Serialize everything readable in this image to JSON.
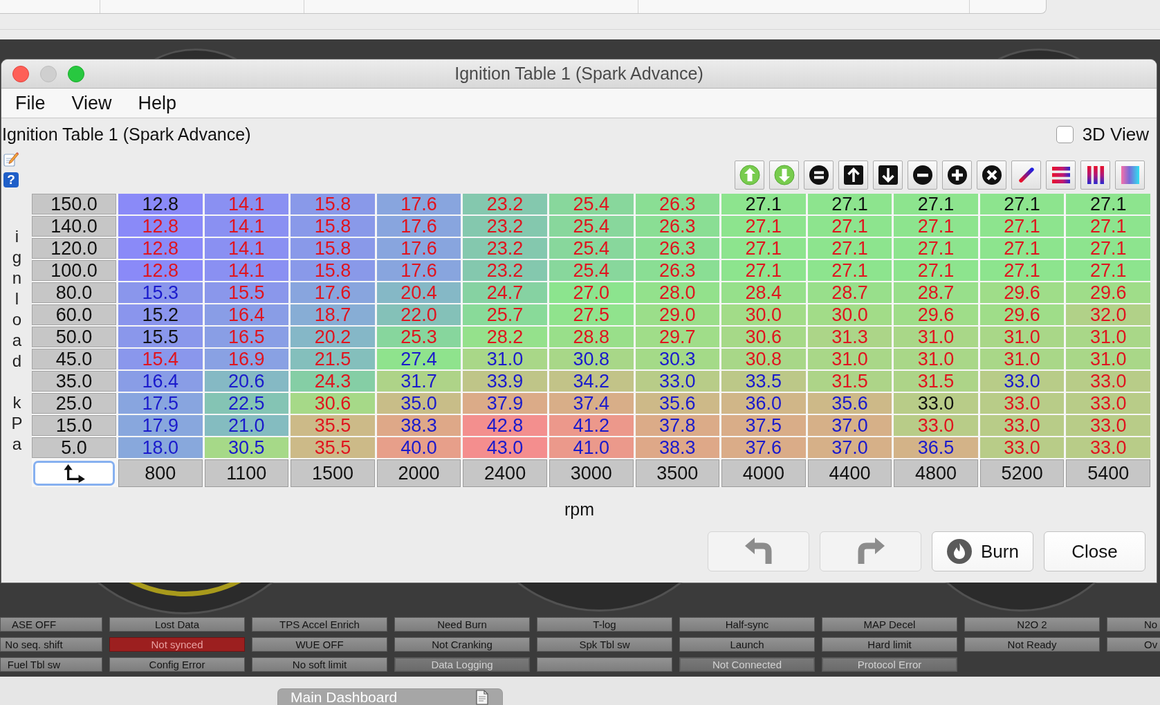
{
  "window": {
    "title": "Ignition Table 1 (Spark Advance)",
    "controls": [
      {
        "kind": "close",
        "disabled": false
      },
      {
        "kind": "minimize",
        "disabled": true
      },
      {
        "kind": "zoom",
        "disabled": false
      }
    ]
  },
  "menu": [
    "File",
    "View",
    "Help"
  ],
  "table_panel": {
    "title": "Ignition Table 1 (Spark Advance)",
    "view_3d": {
      "label": "3D View",
      "checked": false
    },
    "help_glyph": "?",
    "y_axis": {
      "label": "ignload kPa"
    },
    "rows": [
      {
        "load": "150.0",
        "cells": [
          {
            "value": "12.8",
            "color": "#8a8af8",
            "ink": {
              "color": "#111111"
            }
          },
          {
            "value": "14.1",
            "color": "#8a90f2",
            "ink": {
              "color": "#e0141e"
            }
          },
          {
            "value": "15.8",
            "color": "#8999e9",
            "ink": {
              "color": "#e0141e"
            }
          },
          {
            "value": "17.6",
            "color": "#88a5de",
            "ink": {
              "color": "#e0141e"
            }
          },
          {
            "value": "23.2",
            "color": "#84c8ae",
            "ink": {
              "color": "#e0141e"
            }
          },
          {
            "value": "25.4",
            "color": "#88d79c",
            "ink": {
              "color": "#e0141e"
            }
          },
          {
            "value": "26.3",
            "color": "#8ade94",
            "ink": {
              "color": "#e0141e"
            }
          },
          {
            "value": "27.1",
            "color": "#8de48e",
            "ink": {
              "color": "#111111"
            }
          },
          {
            "value": "27.1",
            "color": "#8de48e",
            "ink": {
              "color": "#111111"
            }
          },
          {
            "value": "27.1",
            "color": "#8de48e",
            "ink": {
              "color": "#111111"
            }
          },
          {
            "value": "27.1",
            "color": "#8de48e",
            "ink": {
              "color": "#111111"
            }
          },
          {
            "value": "27.1",
            "color": "#8de48e",
            "ink": {
              "color": "#111111"
            }
          }
        ]
      },
      {
        "load": "140.0",
        "cells": [
          {
            "value": "12.8",
            "color": "#8a8af8",
            "ink": {
              "color": "#e0141e"
            }
          },
          {
            "value": "14.1",
            "color": "#8a90f2",
            "ink": {
              "color": "#e0141e"
            }
          },
          {
            "value": "15.8",
            "color": "#8999e9",
            "ink": {
              "color": "#e0141e"
            }
          },
          {
            "value": "17.6",
            "color": "#88a5de",
            "ink": {
              "color": "#e0141e"
            }
          },
          {
            "value": "23.2",
            "color": "#84c8ae",
            "ink": {
              "color": "#e0141e"
            }
          },
          {
            "value": "25.4",
            "color": "#88d79c",
            "ink": {
              "color": "#e0141e"
            }
          },
          {
            "value": "26.3",
            "color": "#8ade94",
            "ink": {
              "color": "#e0141e"
            }
          },
          {
            "value": "27.1",
            "color": "#8de48e",
            "ink": {
              "color": "#e0141e"
            }
          },
          {
            "value": "27.1",
            "color": "#8de48e",
            "ink": {
              "color": "#e0141e"
            }
          },
          {
            "value": "27.1",
            "color": "#8de48e",
            "ink": {
              "color": "#e0141e"
            }
          },
          {
            "value": "27.1",
            "color": "#8de48e",
            "ink": {
              "color": "#e0141e"
            }
          },
          {
            "value": "27.1",
            "color": "#8de48e",
            "ink": {
              "color": "#e0141e"
            }
          }
        ]
      },
      {
        "load": "120.0",
        "cells": [
          {
            "value": "12.8",
            "color": "#8a8af8",
            "ink": {
              "color": "#e0141e"
            }
          },
          {
            "value": "14.1",
            "color": "#8a90f2",
            "ink": {
              "color": "#e0141e"
            }
          },
          {
            "value": "15.8",
            "color": "#8999e9",
            "ink": {
              "color": "#e0141e"
            }
          },
          {
            "value": "17.6",
            "color": "#88a5de",
            "ink": {
              "color": "#e0141e"
            }
          },
          {
            "value": "23.2",
            "color": "#84c8ae",
            "ink": {
              "color": "#e0141e"
            }
          },
          {
            "value": "25.4",
            "color": "#88d79c",
            "ink": {
              "color": "#e0141e"
            }
          },
          {
            "value": "26.3",
            "color": "#8ade94",
            "ink": {
              "color": "#e0141e"
            }
          },
          {
            "value": "27.1",
            "color": "#8de48e",
            "ink": {
              "color": "#e0141e"
            }
          },
          {
            "value": "27.1",
            "color": "#8de48e",
            "ink": {
              "color": "#e0141e"
            }
          },
          {
            "value": "27.1",
            "color": "#8de48e",
            "ink": {
              "color": "#e0141e"
            }
          },
          {
            "value": "27.1",
            "color": "#8de48e",
            "ink": {
              "color": "#e0141e"
            }
          },
          {
            "value": "27.1",
            "color": "#8de48e",
            "ink": {
              "color": "#e0141e"
            }
          }
        ]
      },
      {
        "load": "100.0",
        "cells": [
          {
            "value": "12.8",
            "color": "#8a8af8",
            "ink": {
              "color": "#e0141e"
            }
          },
          {
            "value": "14.1",
            "color": "#8a90f2",
            "ink": {
              "color": "#e0141e"
            }
          },
          {
            "value": "15.8",
            "color": "#8999e9",
            "ink": {
              "color": "#e0141e"
            }
          },
          {
            "value": "17.6",
            "color": "#88a5de",
            "ink": {
              "color": "#e0141e"
            }
          },
          {
            "value": "23.2",
            "color": "#84c8ae",
            "ink": {
              "color": "#e0141e"
            }
          },
          {
            "value": "25.4",
            "color": "#88d79c",
            "ink": {
              "color": "#e0141e"
            }
          },
          {
            "value": "26.3",
            "color": "#8ade94",
            "ink": {
              "color": "#e0141e"
            }
          },
          {
            "value": "27.1",
            "color": "#8de48e",
            "ink": {
              "color": "#e0141e"
            }
          },
          {
            "value": "27.1",
            "color": "#8de48e",
            "ink": {
              "color": "#e0141e"
            }
          },
          {
            "value": "27.1",
            "color": "#8de48e",
            "ink": {
              "color": "#e0141e"
            }
          },
          {
            "value": "27.1",
            "color": "#8de48e",
            "ink": {
              "color": "#e0141e"
            }
          },
          {
            "value": "27.1",
            "color": "#8de48e",
            "ink": {
              "color": "#e0141e"
            }
          }
        ]
      },
      {
        "load": "80.0",
        "cells": [
          {
            "value": "15.3",
            "color": "#8a96ec",
            "ink": {
              "color": "#1a1acc"
            }
          },
          {
            "value": "15.5",
            "color": "#8a97eb",
            "ink": {
              "color": "#e0141e"
            }
          },
          {
            "value": "17.6",
            "color": "#88a5de",
            "ink": {
              "color": "#e0141e"
            }
          },
          {
            "value": "20.4",
            "color": "#85b8c6",
            "ink": {
              "color": "#e0141e"
            }
          },
          {
            "value": "24.7",
            "color": "#86d2a2",
            "ink": {
              "color": "#e0141e"
            }
          },
          {
            "value": "27.0",
            "color": "#8ce48e",
            "ink": {
              "color": "#e0141e"
            }
          },
          {
            "value": "28.0",
            "color": "#93e18c",
            "ink": {
              "color": "#e0141e"
            }
          },
          {
            "value": "28.4",
            "color": "#96e08b",
            "ink": {
              "color": "#e0141e"
            }
          },
          {
            "value": "28.7",
            "color": "#98df8b",
            "ink": {
              "color": "#e0141e"
            }
          },
          {
            "value": "28.7",
            "color": "#98df8b",
            "ink": {
              "color": "#e0141e"
            }
          },
          {
            "value": "29.6",
            "color": "#9fdd89",
            "ink": {
              "color": "#e0141e"
            }
          },
          {
            "value": "29.6",
            "color": "#9fdd89",
            "ink": {
              "color": "#e0141e"
            }
          }
        ]
      },
      {
        "load": "60.0",
        "cells": [
          {
            "value": "15.2",
            "color": "#8a95ed",
            "ink": {
              "color": "#111111"
            }
          },
          {
            "value": "16.4",
            "color": "#899de6",
            "ink": {
              "color": "#e0141e"
            }
          },
          {
            "value": "18.7",
            "color": "#87add5",
            "ink": {
              "color": "#e0141e"
            }
          },
          {
            "value": "22.0",
            "color": "#84c1b8",
            "ink": {
              "color": "#e0141e"
            }
          },
          {
            "value": "25.7",
            "color": "#89da99",
            "ink": {
              "color": "#e0141e"
            }
          },
          {
            "value": "27.5",
            "color": "#90e38d",
            "ink": {
              "color": "#e0141e"
            }
          },
          {
            "value": "29.0",
            "color": "#9bde8a",
            "ink": {
              "color": "#e0141e"
            }
          },
          {
            "value": "30.0",
            "color": "#a2dc88",
            "ink": {
              "color": "#e0141e"
            }
          },
          {
            "value": "30.0",
            "color": "#a2dc88",
            "ink": {
              "color": "#e0141e"
            }
          },
          {
            "value": "29.6",
            "color": "#9fdd89",
            "ink": {
              "color": "#e0141e"
            }
          },
          {
            "value": "29.6",
            "color": "#9fdd89",
            "ink": {
              "color": "#e0141e"
            }
          },
          {
            "value": "32.0",
            "color": "#b1d188",
            "ink": {
              "color": "#e0141e"
            }
          }
        ]
      },
      {
        "load": "50.0",
        "cells": [
          {
            "value": "15.5",
            "color": "#8a97eb",
            "ink": {
              "color": "#111111"
            }
          },
          {
            "value": "16.5",
            "color": "#899ee5",
            "ink": {
              "color": "#e0141e"
            }
          },
          {
            "value": "20.2",
            "color": "#85b7c7",
            "ink": {
              "color": "#e0141e"
            }
          },
          {
            "value": "25.3",
            "color": "#87d69d",
            "ink": {
              "color": "#e0141e"
            }
          },
          {
            "value": "28.2",
            "color": "#95e18c",
            "ink": {
              "color": "#e0141e"
            }
          },
          {
            "value": "28.8",
            "color": "#99df8a",
            "ink": {
              "color": "#e0141e"
            }
          },
          {
            "value": "29.7",
            "color": "#a0dd89",
            "ink": {
              "color": "#e0141e"
            }
          },
          {
            "value": "30.6",
            "color": "#a6d988",
            "ink": {
              "color": "#e0141e"
            }
          },
          {
            "value": "31.3",
            "color": "#acd588",
            "ink": {
              "color": "#e0141e"
            }
          },
          {
            "value": "31.0",
            "color": "#a9d788",
            "ink": {
              "color": "#e0141e"
            }
          },
          {
            "value": "31.0",
            "color": "#a9d788",
            "ink": {
              "color": "#e0141e"
            }
          },
          {
            "value": "31.0",
            "color": "#a9d788",
            "ink": {
              "color": "#e0141e"
            }
          }
        ]
      },
      {
        "load": "45.0",
        "cells": [
          {
            "value": "15.4",
            "color": "#8a97ec",
            "ink": {
              "color": "#e0141e"
            }
          },
          {
            "value": "16.9",
            "color": "#89a1e3",
            "ink": {
              "color": "#e0141e"
            }
          },
          {
            "value": "21.5",
            "color": "#84bfbc",
            "ink": {
              "color": "#e0141e"
            }
          },
          {
            "value": "27.4",
            "color": "#8fe38d",
            "ink": {
              "color": "#1a1acc"
            }
          },
          {
            "value": "31.0",
            "color": "#a9d788",
            "ink": {
              "color": "#1a1acc"
            }
          },
          {
            "value": "30.8",
            "color": "#a8d788",
            "ink": {
              "color": "#1a1acc"
            }
          },
          {
            "value": "30.3",
            "color": "#a4da88",
            "ink": {
              "color": "#1a1acc"
            }
          },
          {
            "value": "30.8",
            "color": "#a8d788",
            "ink": {
              "color": "#e0141e"
            }
          },
          {
            "value": "31.0",
            "color": "#a9d788",
            "ink": {
              "color": "#e0141e"
            }
          },
          {
            "value": "31.0",
            "color": "#a9d788",
            "ink": {
              "color": "#e0141e"
            }
          },
          {
            "value": "31.0",
            "color": "#a9d788",
            "ink": {
              "color": "#e0141e"
            }
          },
          {
            "value": "31.0",
            "color": "#a9d788",
            "ink": {
              "color": "#e0141e"
            }
          }
        ]
      },
      {
        "load": "35.0",
        "cells": [
          {
            "value": "16.4",
            "color": "#899de6",
            "ink": {
              "color": "#1a1acc"
            }
          },
          {
            "value": "20.6",
            "color": "#85b9c4",
            "ink": {
              "color": "#1a1acc"
            }
          },
          {
            "value": "24.3",
            "color": "#85cea5",
            "ink": {
              "color": "#e0141e"
            }
          },
          {
            "value": "31.7",
            "color": "#aed388",
            "ink": {
              "color": "#1a1acc"
            }
          },
          {
            "value": "33.9",
            "color": "#bfc588",
            "ink": {
              "color": "#1a1acc"
            }
          },
          {
            "value": "34.2",
            "color": "#c2c388",
            "ink": {
              "color": "#1a1acc"
            }
          },
          {
            "value": "33.0",
            "color": "#b8cc88",
            "ink": {
              "color": "#1a1acc"
            }
          },
          {
            "value": "33.5",
            "color": "#bcc888",
            "ink": {
              "color": "#1a1acc"
            }
          },
          {
            "value": "31.5",
            "color": "#add488",
            "ink": {
              "color": "#e0141e"
            }
          },
          {
            "value": "31.5",
            "color": "#add488",
            "ink": {
              "color": "#e0141e"
            }
          },
          {
            "value": "33.0",
            "color": "#b8cc88",
            "ink": {
              "color": "#1a1acc"
            }
          },
          {
            "value": "33.0",
            "color": "#b8cc88",
            "ink": {
              "color": "#e0141e"
            }
          }
        ]
      },
      {
        "load": "25.0",
        "cells": [
          {
            "value": "17.5",
            "color": "#88a5df",
            "ink": {
              "color": "#1a1acc"
            }
          },
          {
            "value": "22.5",
            "color": "#84c4b4",
            "ink": {
              "color": "#1a1acc"
            }
          },
          {
            "value": "30.6",
            "color": "#a6d988",
            "ink": {
              "color": "#e0141e"
            }
          },
          {
            "value": "35.0",
            "color": "#c8bd88",
            "ink": {
              "color": "#1a1acc"
            }
          },
          {
            "value": "37.9",
            "color": "#dbab88",
            "ink": {
              "color": "#1a1acc"
            }
          },
          {
            "value": "37.4",
            "color": "#d8ae88",
            "ink": {
              "color": "#1a1acc"
            }
          },
          {
            "value": "35.6",
            "color": "#cdb988",
            "ink": {
              "color": "#1a1acc"
            }
          },
          {
            "value": "36.0",
            "color": "#d0b688",
            "ink": {
              "color": "#1a1acc"
            }
          },
          {
            "value": "35.6",
            "color": "#cdb988",
            "ink": {
              "color": "#1a1acc"
            }
          },
          {
            "value": "33.0",
            "color": "#b8cc88",
            "ink": {
              "color": "#111111"
            }
          },
          {
            "value": "33.0",
            "color": "#b8cc88",
            "ink": {
              "color": "#e0141e"
            }
          },
          {
            "value": "33.0",
            "color": "#b8cc88",
            "ink": {
              "color": "#e0141e"
            }
          }
        ]
      },
      {
        "load": "15.0",
        "cells": [
          {
            "value": "17.9",
            "color": "#88a7dd",
            "ink": {
              "color": "#1a1acc"
            }
          },
          {
            "value": "21.0",
            "color": "#84bcc0",
            "ink": {
              "color": "#1a1acc"
            }
          },
          {
            "value": "35.5",
            "color": "#ccba88",
            "ink": {
              "color": "#e0141e"
            }
          },
          {
            "value": "38.3",
            "color": "#dea888",
            "ink": {
              "color": "#1a1acc"
            }
          },
          {
            "value": "42.8",
            "color": "#f38f8e",
            "ink": {
              "color": "#1a1acc"
            }
          },
          {
            "value": "41.2",
            "color": "#ec988b",
            "ink": {
              "color": "#1a1acc"
            }
          },
          {
            "value": "37.8",
            "color": "#dbab88",
            "ink": {
              "color": "#1a1acc"
            }
          },
          {
            "value": "37.5",
            "color": "#d9ad88",
            "ink": {
              "color": "#1a1acc"
            }
          },
          {
            "value": "37.0",
            "color": "#d6b088",
            "ink": {
              "color": "#1a1acc"
            }
          },
          {
            "value": "33.0",
            "color": "#b8cc88",
            "ink": {
              "color": "#e0141e"
            }
          },
          {
            "value": "33.0",
            "color": "#b8cc88",
            "ink": {
              "color": "#e0141e"
            }
          },
          {
            "value": "33.0",
            "color": "#b8cc88",
            "ink": {
              "color": "#e0141e"
            }
          }
        ]
      },
      {
        "load": "5.0",
        "cells": [
          {
            "value": "18.0",
            "color": "#88a8dc",
            "ink": {
              "color": "#1a1acc"
            }
          },
          {
            "value": "30.5",
            "color": "#a6d988",
            "ink": {
              "color": "#1a1acc"
            }
          },
          {
            "value": "35.5",
            "color": "#ccba88",
            "ink": {
              "color": "#e0141e"
            }
          },
          {
            "value": "40.0",
            "color": "#e79f8a",
            "ink": {
              "color": "#1a1acc"
            }
          },
          {
            "value": "43.0",
            "color": "#f48e8e",
            "ink": {
              "color": "#1a1acc"
            }
          },
          {
            "value": "41.0",
            "color": "#eb998b",
            "ink": {
              "color": "#1a1acc"
            }
          },
          {
            "value": "38.3",
            "color": "#dea888",
            "ink": {
              "color": "#1a1acc"
            }
          },
          {
            "value": "37.6",
            "color": "#daac88",
            "ink": {
              "color": "#1a1acc"
            }
          },
          {
            "value": "37.0",
            "color": "#d6b088",
            "ink": {
              "color": "#1a1acc"
            }
          },
          {
            "value": "36.5",
            "color": "#d3b388",
            "ink": {
              "color": "#1a1acc"
            }
          },
          {
            "value": "33.0",
            "color": "#b8cc88",
            "ink": {
              "color": "#e0141e"
            }
          },
          {
            "value": "33.0",
            "color": "#b8cc88",
            "ink": {
              "color": "#e0141e"
            }
          }
        ]
      }
    ],
    "x_axis": {
      "values": [
        "800",
        "1100",
        "1500",
        "2000",
        "2400",
        "3000",
        "3500",
        "4000",
        "4400",
        "4800",
        "5200",
        "5400"
      ],
      "label": "rpm"
    }
  },
  "buttons": [
    {
      "kind": "undo",
      "disabled": true
    },
    {
      "kind": "redo",
      "disabled": true
    },
    {
      "kind": "burn",
      "label": "Burn",
      "disabled": false
    },
    {
      "kind": "close",
      "label": "Close",
      "disabled": false
    }
  ],
  "indicators": [
    {
      "items": [
        {
          "label": "ASE OFF",
          "on": false,
          "disabled": false
        },
        {
          "label": "No seq. shift",
          "on": false,
          "disabled": false
        },
        {
          "label": "Fuel Tbl sw",
          "on": false,
          "disabled": false
        }
      ]
    },
    {
      "items": [
        {
          "label": "Lost Data",
          "on": false,
          "disabled": false
        },
        {
          "label": "Not synced",
          "on": true,
          "disabled": false
        },
        {
          "label": "Config Error",
          "on": false,
          "disabled": false
        }
      ]
    },
    {
      "items": [
        {
          "label": "TPS Accel Enrich",
          "on": false,
          "disabled": false
        },
        {
          "label": "WUE OFF",
          "on": false,
          "disabled": false
        },
        {
          "label": "No soft limit",
          "on": false,
          "disabled": false
        }
      ]
    },
    {
      "items": [
        {
          "label": "Need Burn",
          "on": false,
          "disabled": false
        },
        {
          "label": "Not Cranking",
          "on": false,
          "disabled": false
        },
        {
          "label": "Data Logging",
          "on": false,
          "disabled": true
        }
      ]
    },
    {
      "items": [
        {
          "label": "T-log",
          "on": false,
          "disabled": false
        },
        {
          "label": "Spk Tbl sw",
          "on": false,
          "disabled": false
        },
        {
          "on": false,
          "disabled": false
        }
      ]
    },
    {
      "items": [
        {
          "label": "Half-sync",
          "on": false,
          "disabled": false
        },
        {
          "label": "Launch",
          "on": false,
          "disabled": false
        },
        {
          "label": "Not Connected",
          "on": false,
          "disabled": true
        }
      ]
    },
    {
      "items": [
        {
          "label": "MAP Decel",
          "on": false,
          "disabled": false
        },
        {
          "label": "Hard limit",
          "on": false,
          "disabled": false
        },
        {
          "label": "Protocol Error",
          "on": false,
          "disabled": true
        }
      ]
    },
    {
      "items": [
        {
          "label": "N2O 2",
          "on": false,
          "disabled": false
        },
        {
          "label": "Not Ready",
          "on": false,
          "disabled": false
        }
      ]
    },
    {
      "items": [
        {
          "label": "No",
          "on": false,
          "disabled": false
        },
        {
          "label": "Ov",
          "on": false,
          "disabled": false
        }
      ]
    }
  ],
  "dashboard_tab": {
    "label": "Main Dashboard"
  }
}
